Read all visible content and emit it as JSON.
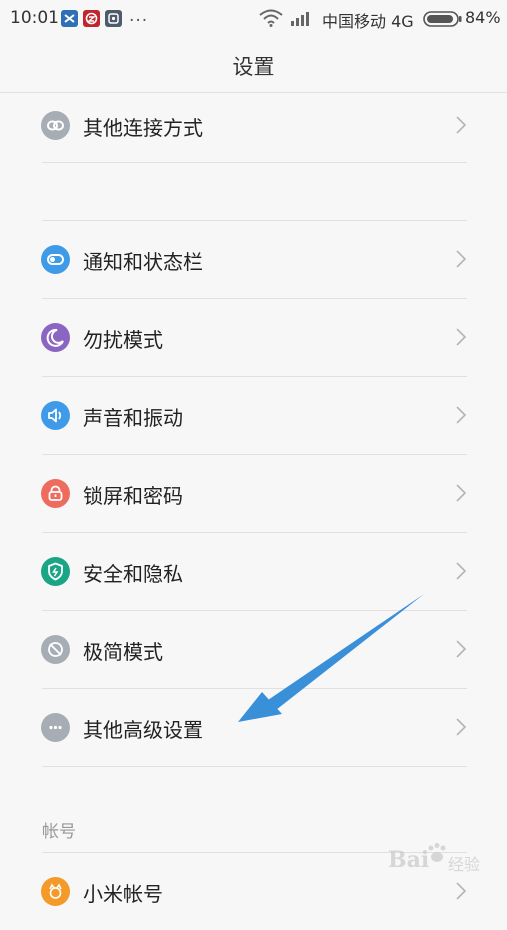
{
  "status_bar": {
    "time": "10:01",
    "more": "...",
    "carrier": "中国移动 4G",
    "battery": "84%"
  },
  "header": {
    "title": "设置"
  },
  "items": [
    {
      "label": "其他连接方式",
      "icon": "link-icon",
      "color": "#a7adb5"
    },
    {
      "label": "通知和状态栏",
      "icon": "toggle-icon",
      "color": "#3f9be8"
    },
    {
      "label": "勿扰模式",
      "icon": "moon-icon",
      "color": "#8a66c2"
    },
    {
      "label": "声音和振动",
      "icon": "speaker-icon",
      "color": "#3f9be8"
    },
    {
      "label": "锁屏和密码",
      "icon": "lock-icon",
      "color": "#ee6c5e"
    },
    {
      "label": "安全和隐私",
      "icon": "shield-icon",
      "color": "#1aa685"
    },
    {
      "label": "极简模式",
      "icon": "minimal-mode-icon",
      "color": "#a7adb5"
    },
    {
      "label": "其他高级设置",
      "icon": "more-dots-icon",
      "color": "#a7adb5"
    },
    {
      "label": "小米帐号",
      "icon": "mi-account-icon",
      "color": "#f39a2b"
    }
  ],
  "sections": {
    "account": "帐号"
  },
  "watermark": {
    "brand": "Bai",
    "sub": "经验"
  }
}
